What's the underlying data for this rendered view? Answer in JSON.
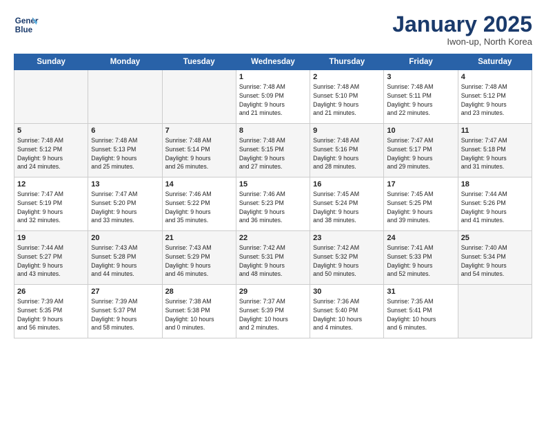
{
  "logo": {
    "line1": "General",
    "line2": "Blue"
  },
  "title": "January 2025",
  "subtitle": "Iwon-up, North Korea",
  "days_header": [
    "Sunday",
    "Monday",
    "Tuesday",
    "Wednesday",
    "Thursday",
    "Friday",
    "Saturday"
  ],
  "weeks": [
    [
      {
        "day": "",
        "info": ""
      },
      {
        "day": "",
        "info": ""
      },
      {
        "day": "",
        "info": ""
      },
      {
        "day": "1",
        "info": "Sunrise: 7:48 AM\nSunset: 5:09 PM\nDaylight: 9 hours\nand 21 minutes."
      },
      {
        "day": "2",
        "info": "Sunrise: 7:48 AM\nSunset: 5:10 PM\nDaylight: 9 hours\nand 21 minutes."
      },
      {
        "day": "3",
        "info": "Sunrise: 7:48 AM\nSunset: 5:11 PM\nDaylight: 9 hours\nand 22 minutes."
      },
      {
        "day": "4",
        "info": "Sunrise: 7:48 AM\nSunset: 5:12 PM\nDaylight: 9 hours\nand 23 minutes."
      }
    ],
    [
      {
        "day": "5",
        "info": "Sunrise: 7:48 AM\nSunset: 5:12 PM\nDaylight: 9 hours\nand 24 minutes."
      },
      {
        "day": "6",
        "info": "Sunrise: 7:48 AM\nSunset: 5:13 PM\nDaylight: 9 hours\nand 25 minutes."
      },
      {
        "day": "7",
        "info": "Sunrise: 7:48 AM\nSunset: 5:14 PM\nDaylight: 9 hours\nand 26 minutes."
      },
      {
        "day": "8",
        "info": "Sunrise: 7:48 AM\nSunset: 5:15 PM\nDaylight: 9 hours\nand 27 minutes."
      },
      {
        "day": "9",
        "info": "Sunrise: 7:48 AM\nSunset: 5:16 PM\nDaylight: 9 hours\nand 28 minutes."
      },
      {
        "day": "10",
        "info": "Sunrise: 7:47 AM\nSunset: 5:17 PM\nDaylight: 9 hours\nand 29 minutes."
      },
      {
        "day": "11",
        "info": "Sunrise: 7:47 AM\nSunset: 5:18 PM\nDaylight: 9 hours\nand 31 minutes."
      }
    ],
    [
      {
        "day": "12",
        "info": "Sunrise: 7:47 AM\nSunset: 5:19 PM\nDaylight: 9 hours\nand 32 minutes."
      },
      {
        "day": "13",
        "info": "Sunrise: 7:47 AM\nSunset: 5:20 PM\nDaylight: 9 hours\nand 33 minutes."
      },
      {
        "day": "14",
        "info": "Sunrise: 7:46 AM\nSunset: 5:22 PM\nDaylight: 9 hours\nand 35 minutes."
      },
      {
        "day": "15",
        "info": "Sunrise: 7:46 AM\nSunset: 5:23 PM\nDaylight: 9 hours\nand 36 minutes."
      },
      {
        "day": "16",
        "info": "Sunrise: 7:45 AM\nSunset: 5:24 PM\nDaylight: 9 hours\nand 38 minutes."
      },
      {
        "day": "17",
        "info": "Sunrise: 7:45 AM\nSunset: 5:25 PM\nDaylight: 9 hours\nand 39 minutes."
      },
      {
        "day": "18",
        "info": "Sunrise: 7:44 AM\nSunset: 5:26 PM\nDaylight: 9 hours\nand 41 minutes."
      }
    ],
    [
      {
        "day": "19",
        "info": "Sunrise: 7:44 AM\nSunset: 5:27 PM\nDaylight: 9 hours\nand 43 minutes."
      },
      {
        "day": "20",
        "info": "Sunrise: 7:43 AM\nSunset: 5:28 PM\nDaylight: 9 hours\nand 44 minutes."
      },
      {
        "day": "21",
        "info": "Sunrise: 7:43 AM\nSunset: 5:29 PM\nDaylight: 9 hours\nand 46 minutes."
      },
      {
        "day": "22",
        "info": "Sunrise: 7:42 AM\nSunset: 5:31 PM\nDaylight: 9 hours\nand 48 minutes."
      },
      {
        "day": "23",
        "info": "Sunrise: 7:42 AM\nSunset: 5:32 PM\nDaylight: 9 hours\nand 50 minutes."
      },
      {
        "day": "24",
        "info": "Sunrise: 7:41 AM\nSunset: 5:33 PM\nDaylight: 9 hours\nand 52 minutes."
      },
      {
        "day": "25",
        "info": "Sunrise: 7:40 AM\nSunset: 5:34 PM\nDaylight: 9 hours\nand 54 minutes."
      }
    ],
    [
      {
        "day": "26",
        "info": "Sunrise: 7:39 AM\nSunset: 5:35 PM\nDaylight: 9 hours\nand 56 minutes."
      },
      {
        "day": "27",
        "info": "Sunrise: 7:39 AM\nSunset: 5:37 PM\nDaylight: 9 hours\nand 58 minutes."
      },
      {
        "day": "28",
        "info": "Sunrise: 7:38 AM\nSunset: 5:38 PM\nDaylight: 10 hours\nand 0 minutes."
      },
      {
        "day": "29",
        "info": "Sunrise: 7:37 AM\nSunset: 5:39 PM\nDaylight: 10 hours\nand 2 minutes."
      },
      {
        "day": "30",
        "info": "Sunrise: 7:36 AM\nSunset: 5:40 PM\nDaylight: 10 hours\nand 4 minutes."
      },
      {
        "day": "31",
        "info": "Sunrise: 7:35 AM\nSunset: 5:41 PM\nDaylight: 10 hours\nand 6 minutes."
      },
      {
        "day": "",
        "info": ""
      }
    ]
  ]
}
